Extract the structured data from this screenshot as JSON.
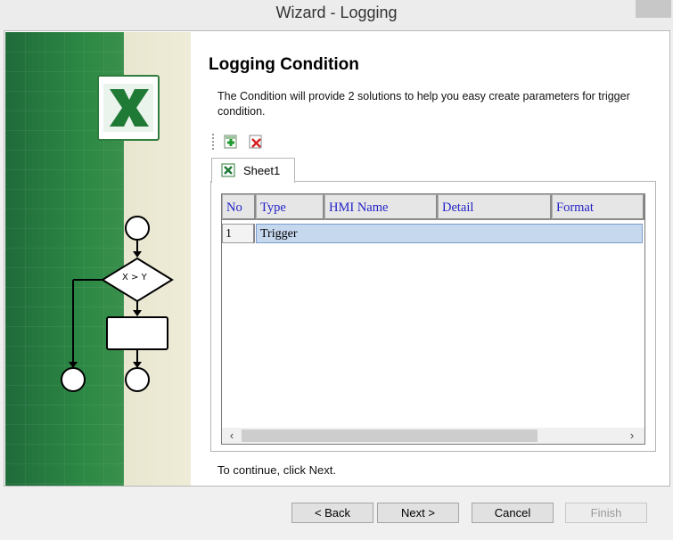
{
  "window": {
    "title": "Wizard - Logging"
  },
  "page": {
    "heading": "Logging Condition",
    "description": "The Condition will provide 2 solutions to  help you easy create parameters for trigger condition.",
    "continue_hint": "To continue, click Next."
  },
  "toolbar": {
    "add_icon": "add-sheet-icon",
    "delete_icon": "delete-sheet-icon"
  },
  "tabs": [
    {
      "label": "Sheet1",
      "icon": "excel-sheet-icon",
      "selected": true
    }
  ],
  "grid": {
    "columns": [
      "No",
      "Type",
      "HMI Name",
      "Detail",
      "Format"
    ],
    "rows": [
      {
        "no": "1",
        "type": "Trigger",
        "selected": true
      }
    ]
  },
  "flowchart": {
    "decision_label": "X > Y"
  },
  "buttons": {
    "back": "< Back",
    "next": "Next >",
    "cancel": "Cancel",
    "finish": "Finish"
  },
  "colors": {
    "header_text": "#2323c8",
    "selected_row": "#c6d8ee",
    "banner_green": "#2d8a45"
  }
}
